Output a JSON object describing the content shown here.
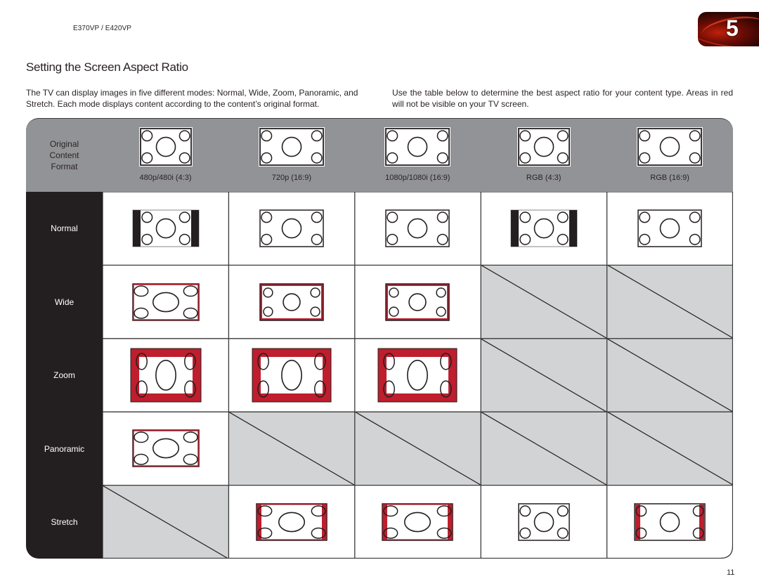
{
  "header": {
    "model": "E370VP / E420VP",
    "chapter_number": "5",
    "page_number": "11"
  },
  "title": "Setting the Screen Aspect Ratio",
  "intro": {
    "left": "The TV can display images in five different modes: Normal, Wide, Zoom, Panoramic, and Stretch. Each mode displays content according to the content’s original format.",
    "right": "Use the table below to determine the best aspect ratio for your content type. Areas in red will not be visible on your TV screen."
  },
  "table": {
    "header_label": [
      "Original",
      "Content",
      "Format"
    ],
    "formats": [
      {
        "label": "480p/480i (4:3)",
        "aspect": "4:3"
      },
      {
        "label": "720p (16:9)",
        "aspect": "16:9"
      },
      {
        "label": "1080p/1080i (16:9)",
        "aspect": "16:9"
      },
      {
        "label": "RGB (4:3)",
        "aspect": "4:3"
      },
      {
        "label": "RGB (16:9)",
        "aspect": "16:9"
      }
    ],
    "modes": [
      {
        "label": "Normal",
        "cells": [
          "pillarbox",
          "fit",
          "fit",
          "pillarbox",
          "fit"
        ]
      },
      {
        "label": "Wide",
        "cells": [
          "stretch-wide",
          "wide-thin",
          "wide-thin",
          "unavailable",
          "unavailable"
        ]
      },
      {
        "label": "Zoom",
        "cells": [
          "zoom",
          "zoom",
          "zoom",
          "unavailable",
          "unavailable"
        ]
      },
      {
        "label": "Panoramic",
        "cells": [
          "panoramic",
          "unavailable",
          "unavailable",
          "unavailable",
          "unavailable"
        ]
      },
      {
        "label": "Stretch",
        "cells": [
          "unavailable",
          "stretch-side",
          "stretch-side",
          "fit",
          "stretch-side-thin"
        ]
      }
    ]
  },
  "colors": {
    "header_gray": "#929396",
    "sidebar_black": "#231f20",
    "unavailable_gray": "#d1d3d4",
    "cropped_red": "#be1e2d",
    "text": "#2a2325"
  }
}
